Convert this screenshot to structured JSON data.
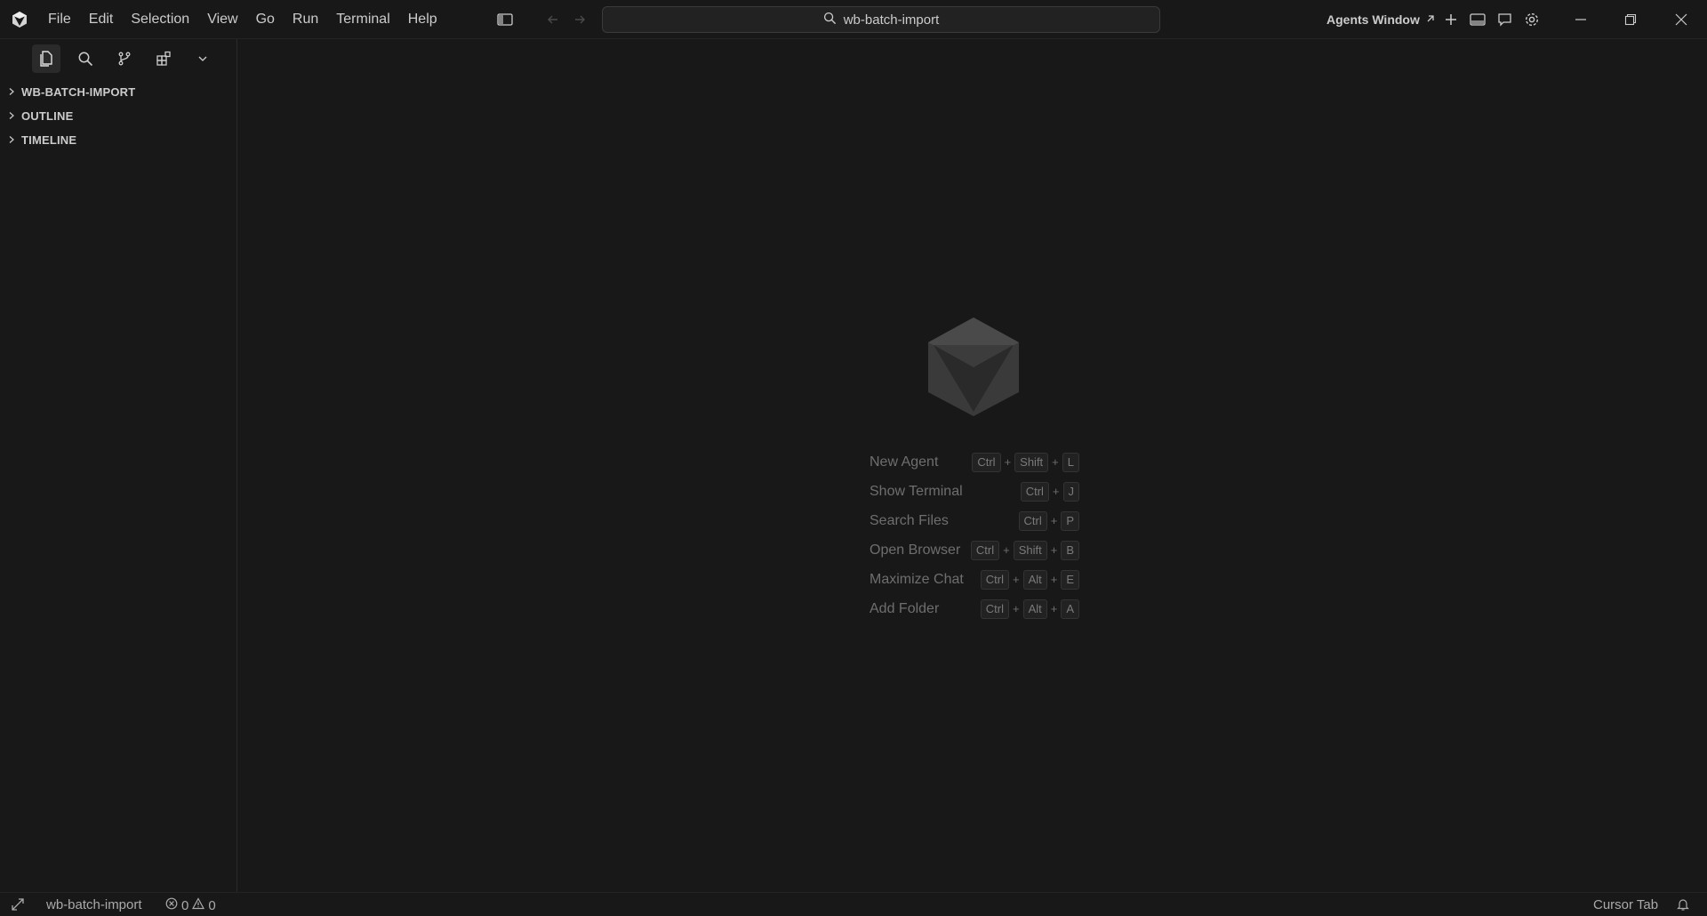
{
  "app": {
    "logo_icon": "cursor-logo-icon"
  },
  "menu": [
    "File",
    "Edit",
    "Selection",
    "View",
    "Go",
    "Run",
    "Terminal",
    "Help"
  ],
  "search": {
    "text": "wb-batch-import",
    "icon": "search-icon"
  },
  "titlebar_right": {
    "agents_window_label": "Agents Window",
    "icons": [
      "external-arrow-icon",
      "plus-icon",
      "panel-toggle-icon",
      "chat-icon",
      "settings-icon"
    ]
  },
  "window_controls": [
    "minimize-icon",
    "restore-icon",
    "close-icon"
  ],
  "activity_bar": [
    "explorer-icon",
    "search-icon",
    "source-control-icon",
    "extensions-icon",
    "chevron-down-icon"
  ],
  "sidebar": {
    "sections": [
      {
        "label": "WB-BATCH-IMPORT"
      },
      {
        "label": "OUTLINE"
      },
      {
        "label": "TIMELINE"
      }
    ]
  },
  "editor": {
    "shortcuts": [
      {
        "label": "New Agent",
        "keys": [
          "Ctrl",
          "Shift",
          "L"
        ]
      },
      {
        "label": "Show Terminal",
        "keys": [
          "Ctrl",
          "J"
        ]
      },
      {
        "label": "Search Files",
        "keys": [
          "Ctrl",
          "P"
        ]
      },
      {
        "label": "Open Browser",
        "keys": [
          "Ctrl",
          "Shift",
          "B"
        ]
      },
      {
        "label": "Maximize Chat",
        "keys": [
          "Ctrl",
          "Alt",
          "E"
        ]
      },
      {
        "label": "Add Folder",
        "keys": [
          "Ctrl",
          "Alt",
          "A"
        ]
      }
    ],
    "plus_sign": "+"
  },
  "statusbar": {
    "workspace": "wb-batch-import",
    "errors": "0",
    "warnings": "0",
    "right_label": "Cursor Tab"
  }
}
